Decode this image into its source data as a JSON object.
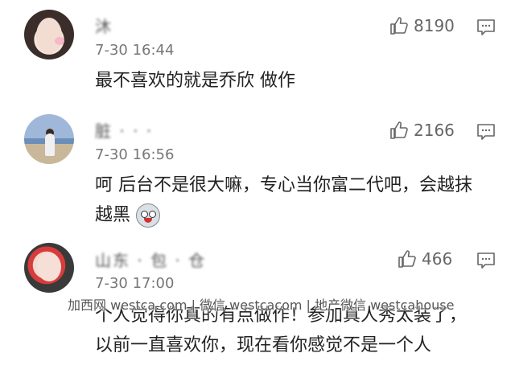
{
  "comments": [
    {
      "name": "沐 ",
      "time": "7-30 16:44",
      "likes": "8190",
      "text": "最不喜欢的就是乔欣  做作",
      "avatar_icon": "user-avatar"
    },
    {
      "name": "脏 · · ·",
      "time": "7-30 16:56",
      "likes": "2166",
      "text": "呵  后台不是很大嘛，专心当你富二代吧，会越抹越黑",
      "emoji_icon": "shocked-face-emoji"
    },
    {
      "name": "山东 · 包 · 仓",
      "time": "7-30 17:00",
      "likes": "466",
      "text": "个人觉得你真的有点做作！参加真人秀太装了，以前一直喜欢你，现在看你感觉不是一个人"
    }
  ],
  "watermark": "加西网 westca.com | 微信 westcacom | 地产微信 westcahouse",
  "colors": {
    "icon_gray": "#666666",
    "text": "#222222",
    "meta": "#777777"
  },
  "icons": {
    "like": "thumbs-up-icon",
    "reply": "comment-reply-icon"
  }
}
